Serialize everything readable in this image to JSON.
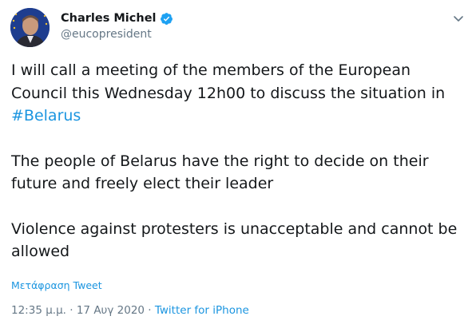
{
  "author": {
    "display_name": "Charles Michel",
    "handle": "@eucopresident",
    "verified": true
  },
  "tweet": {
    "line1_text": "I will call a meeting of the members of the European Council this Wednesday 12h00 to discuss the situation in ",
    "hashtag": "#Belarus",
    "paragraph2": "The people of Belarus have the right to decide on their future and freely elect their leader",
    "paragraph3": "Violence against protesters is unacceptable and cannot be allowed"
  },
  "translate_label": "Μετάφραση Tweet",
  "meta": {
    "time": "12:35 μ.μ.",
    "separator": " · ",
    "date": "17 Αυγ 2020",
    "separator2": " · ",
    "source": "Twitter for iPhone"
  },
  "colors": {
    "link": "#1b95e0",
    "secondary_text": "#657786",
    "primary_text": "#14171a",
    "verified_badge": "#1da1f2"
  },
  "icons": {
    "verified": "verified-badge-icon",
    "caret": "chevron-down-icon"
  }
}
